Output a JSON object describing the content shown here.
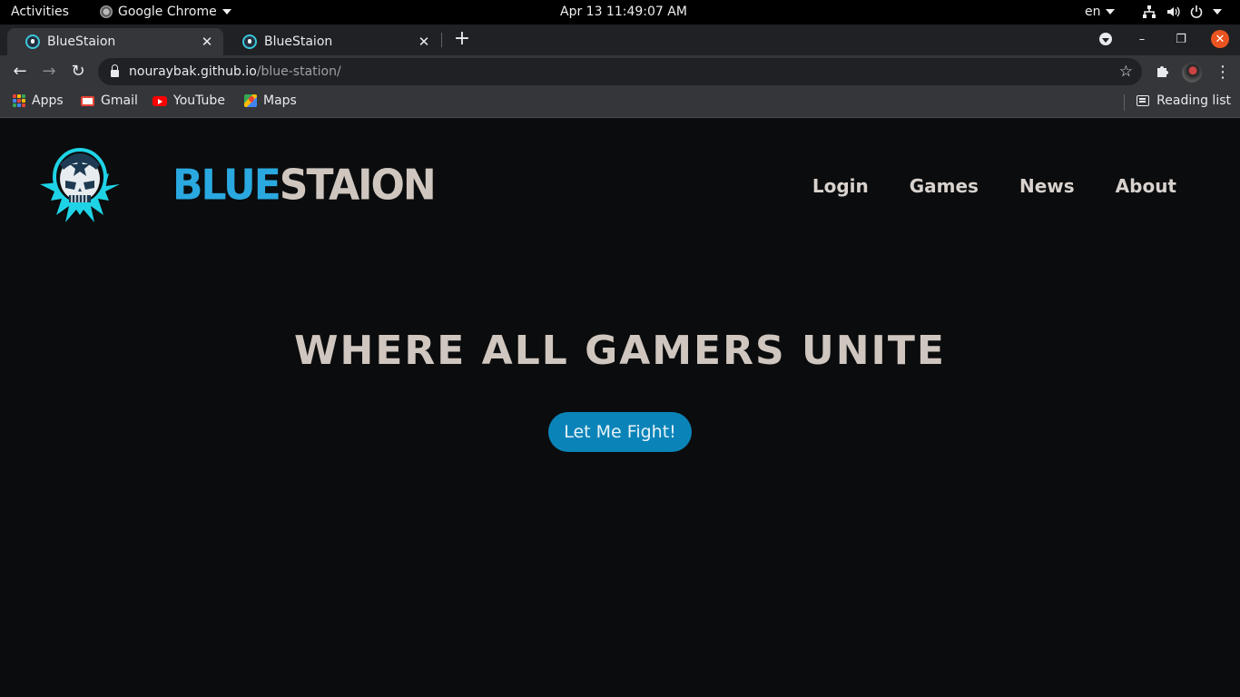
{
  "system_bar": {
    "activities": "Activities",
    "app_name": "Google Chrome",
    "clock": "Apr 13  11:49:07 AM",
    "language": "en"
  },
  "tabs": [
    {
      "title": "BlueStaion",
      "active": true
    },
    {
      "title": "BlueStaion",
      "active": false
    }
  ],
  "toolbar": {
    "url_host": "nouraybak.github.io",
    "url_path": "/blue-station/"
  },
  "bookmarks": {
    "items": [
      {
        "label": "Apps",
        "icon": "apps-grid-icon"
      },
      {
        "label": "Gmail",
        "icon": "gmail-icon"
      },
      {
        "label": "YouTube",
        "icon": "youtube-icon"
      },
      {
        "label": "Maps",
        "icon": "maps-icon"
      }
    ],
    "reading_list": "Reading list"
  },
  "site": {
    "brand_blue": "BLUE",
    "brand_grey": "STAION",
    "nav": [
      "Login",
      "Games",
      "News",
      "About"
    ],
    "hero_title": "WHERE ALL GAMERS UNITE",
    "cta_label": "Let Me Fight!"
  },
  "colors": {
    "page_bg": "#0b0c0d",
    "brand_blue": "#2aa9e0",
    "text_light": "#cfc6bf",
    "cta_bg": "#0a84b8",
    "ubuntu_close": "#e95420"
  }
}
